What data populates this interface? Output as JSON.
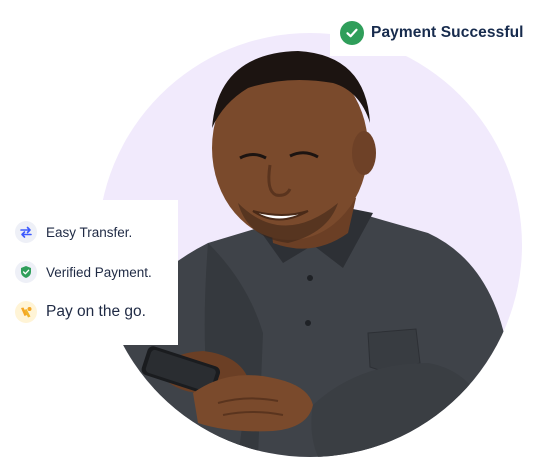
{
  "notification": {
    "text": "Payment Successful",
    "icon": "check-circle-icon",
    "color": "#2f9e5a"
  },
  "features": {
    "items": [
      {
        "label": "Easy Transfer.",
        "icon": "transfer-arrows-icon",
        "color": "#3d5afe"
      },
      {
        "label": "Verified Payment.",
        "icon": "shield-check-icon",
        "color": "#2f9e5a"
      },
      {
        "label": "Pay on the go.",
        "icon": "hand-coin-icon",
        "color": "#f5a623"
      }
    ]
  },
  "colors": {
    "circle_bg": "#f1eafc",
    "text_dark": "#172b4d"
  }
}
